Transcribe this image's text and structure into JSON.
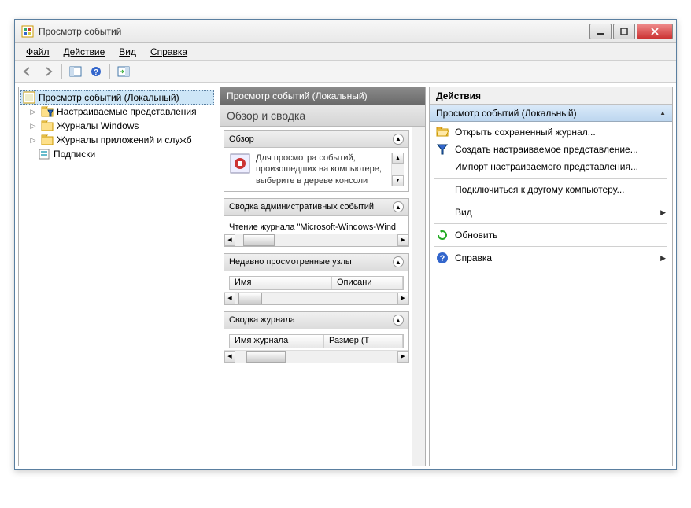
{
  "window": {
    "title": "Просмотр событий"
  },
  "menu": {
    "file": "Файл",
    "action": "Действие",
    "view": "Вид",
    "help": "Справка"
  },
  "tree": {
    "root": "Просмотр событий (Локальный)",
    "items": [
      "Настраиваемые представления",
      "Журналы Windows",
      "Журналы приложений и служб",
      "Подписки"
    ]
  },
  "mid": {
    "header": "Просмотр событий (Локальный)",
    "subtitle": "Обзор и сводка",
    "sections": {
      "overview": {
        "title": "Обзор",
        "text": "Для просмотра событий, произошедших на компьютере, выберите в дереве консоли"
      },
      "admin": {
        "title": "Сводка административных событий",
        "text": "Чтение журнала \"Microsoft-Windows-Wind"
      },
      "recent": {
        "title": "Недавно просмотренные узлы",
        "col1": "Имя",
        "col2": "Описани"
      },
      "summary": {
        "title": "Сводка журнала",
        "col1": "Имя журнала",
        "col2": "Размер (Т"
      }
    }
  },
  "right": {
    "header": "Действия",
    "sub": "Просмотр событий (Локальный)",
    "actions": [
      "Открыть сохраненный журнал...",
      "Создать настраиваемое представление...",
      "Импорт настраиваемого представления...",
      "Подключиться к другому компьютеру...",
      "Вид",
      "Обновить",
      "Справка"
    ]
  }
}
